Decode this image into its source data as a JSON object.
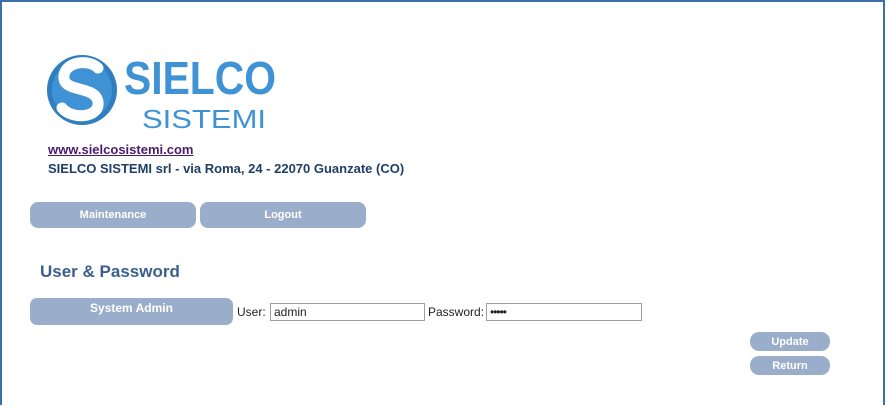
{
  "header": {
    "logo_text": "SIELCO",
    "logo_subtext": "SISTEMI",
    "website_link": "www.sielcosistemi.com",
    "address": "SIELCO SISTEMI srl - via Roma, 24 - 22070 Guanzate (CO)"
  },
  "nav": {
    "maintenance_label": "Maintenance",
    "logout_label": "Logout"
  },
  "main": {
    "section_title": "User & Password",
    "row": {
      "label": "System Admin",
      "user_label": "User:",
      "user_value": "admin",
      "password_label": "Password:",
      "password_value": "•••••"
    }
  },
  "actions": {
    "update_label": "Update",
    "return_label": "Return"
  },
  "colors": {
    "frame": "#3f6fa8",
    "button_bg": "#9aaecb",
    "title": "#3a5f8e",
    "address": "#1e3f66",
    "link": "#4a1a6b",
    "logo_blue": "#2f7fc0"
  }
}
